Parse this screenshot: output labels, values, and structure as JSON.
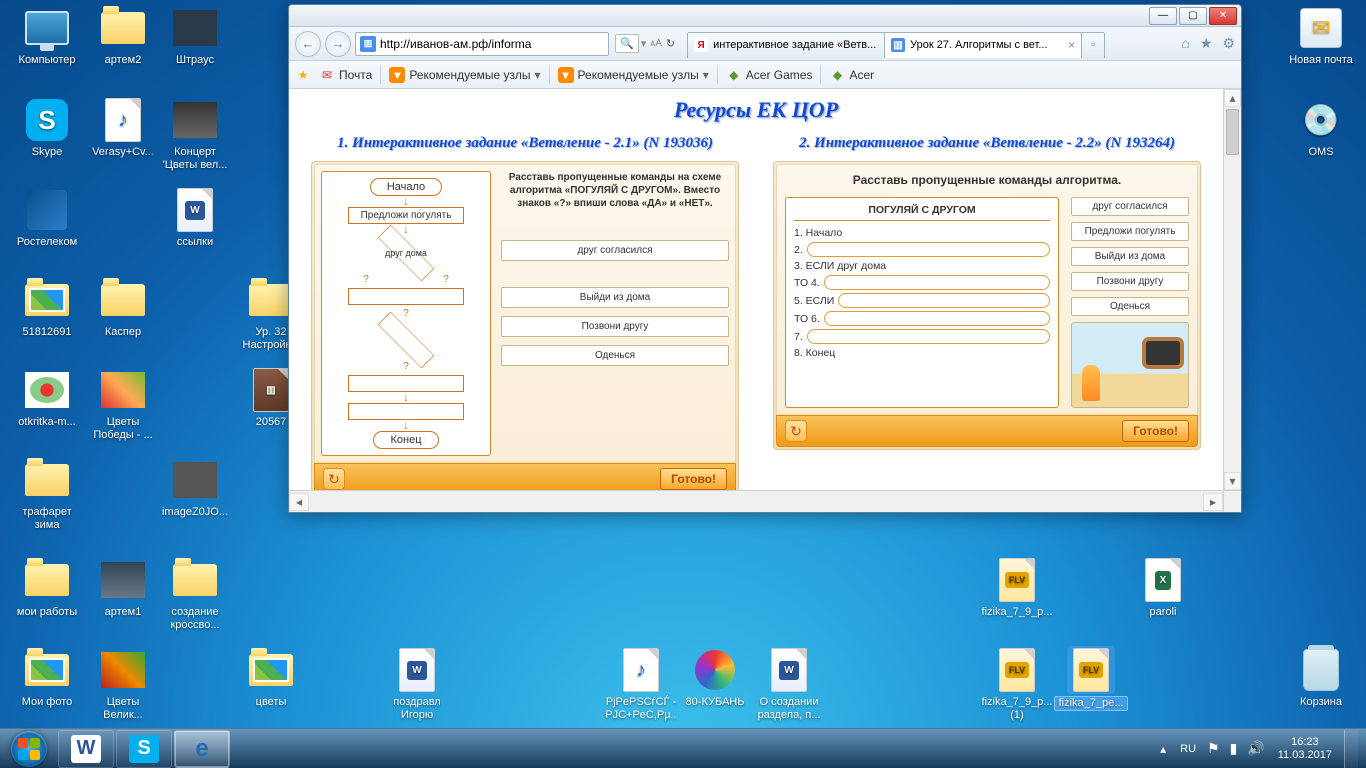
{
  "desktop_icons": {
    "computer": "Компьютер",
    "artem2": "артем2",
    "shtraus": "Штраус",
    "skype": "Skype",
    "verasy": "Verasy+Cv...",
    "concert": "Концерт 'Цветы вел...",
    "rostelecom": "Ростелеком",
    "links": "ссылки",
    "id51812691": "51812691",
    "kasper": "Каспер",
    "urok32": "Ур. 32 Настройк...",
    "otkritka": "otkritka-m...",
    "pobedy": "Цветы Победы - ...",
    "r20567": "20567",
    "trafaret": "трафарет зима",
    "imagez": "imageZ0JO...",
    "moiraboty": "мои работы",
    "artem1": "артем1",
    "sozdanie": "создание кроссво...",
    "moifoto": "Мои фото",
    "tsvety_velik": "Цветы Велик...",
    "tsvety": "цветы",
    "pozdrav": "поздравл Игорю",
    "pjpe": "PjPePSCѓCЃ - PJC+PeC,Pµ...",
    "kuban": "80-КУБАНЬ",
    "osozdanii": "О создании раздела, п...",
    "fizika1": "fizika_7_9_p...",
    "paroli": "paroli",
    "fizika2": "fizika_7_9_p... (1)",
    "fizika3": "fizika_7_pe...",
    "novaya": "Новая почта",
    "oms": "OMS",
    "korzina": "Корзина"
  },
  "ie": {
    "url": "http://иванов-ам.рф/informa",
    "tabs": [
      {
        "label": "интерактивное задание «Ветв...",
        "icon": "Я",
        "color": "#ffcc00",
        "text": "#d00"
      },
      {
        "label": "Урок 27. Алгоритмы с вет...",
        "icon": "▥",
        "color": "#4a8fe7",
        "text": "#fff"
      }
    ],
    "favbar": {
      "mail": "Почта",
      "rec1": "Рекомендуемые узлы",
      "rec2": "Рекомендуемые узлы",
      "acergames": "Acer Games",
      "acer": "Acer"
    }
  },
  "page": {
    "title": "Ресурсы ЕК ЦОР",
    "col1_title": "1. Интерактивное задание «Ветвление - 2.1» (N 193036)",
    "col2_title": "2. Интерактивное задание «Ветвление - 2.2» (N 193264)",
    "task1": {
      "instr": "Расставь пропущенные команды на схеме алгоритма «ПОГУЛЯЙ С ДРУГОМ». Вместо знаков «?» впиши слова «ДА» и «НЕТ».",
      "start": "Начало",
      "step1": "Предложи погулять",
      "cond": "друг дома",
      "end": "Конец",
      "choices": [
        "друг согласился",
        "Выйди из дома",
        "Позвони другу",
        "Оденься"
      ],
      "done": "Готово!"
    },
    "task2": {
      "instr": "Расставь пропущенные команды алгоритма.",
      "header": "ПОГУЛЯЙ С ДРУГОМ",
      "l1": "1. Начало",
      "l2": "2.",
      "l3": "3. ЕСЛИ друг дома",
      "l4": "ТО 4.",
      "l5": "5. ЕСЛИ",
      "l6": "ТО 6.",
      "l7": "7.",
      "l8": "8. Конец",
      "choices": [
        "друг согласился",
        "Предложи погулять",
        "Выйди из дома",
        "Позвони другу",
        "Оденься"
      ],
      "done": "Готово!"
    }
  },
  "taskbar": {
    "lang": "RU",
    "time": "16:23",
    "date": "11.03.2017"
  }
}
